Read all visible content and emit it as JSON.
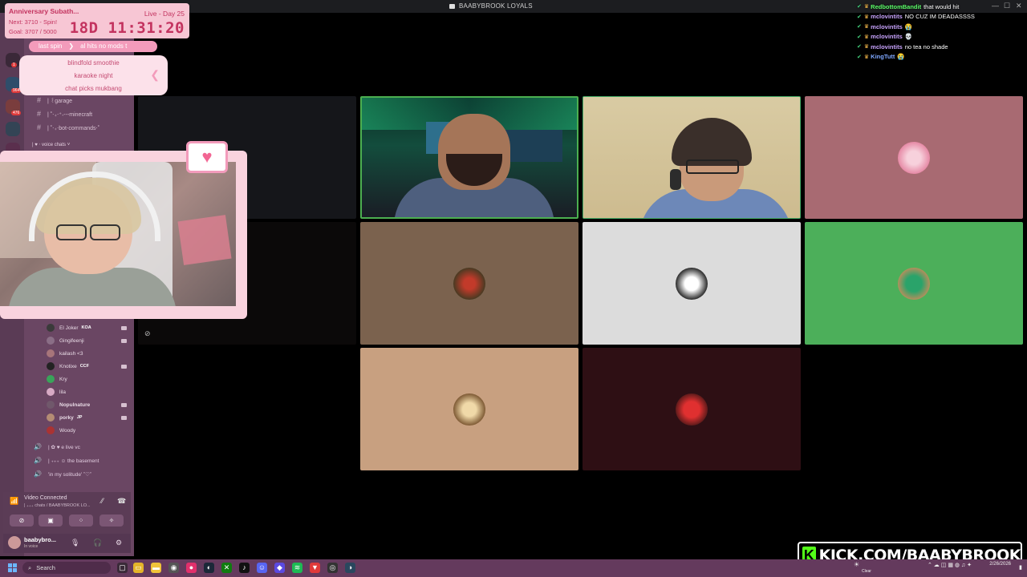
{
  "window": {
    "title": "BAABYBROOK LOYALS"
  },
  "timer": {
    "title": "Anniversary Subath...",
    "next": "Next: 3710 - Spin!",
    "goal": "Goal: 3707 / 5000",
    "live": "Live - Day 25",
    "clock": "18D 11:31:20"
  },
  "spin": {
    "label": "last spin",
    "value": "al hits no mods t"
  },
  "wheel": {
    "options": [
      "blindfold smoothie",
      "karaoke night",
      "chat picks mukbang"
    ]
  },
  "sidebar": {
    "badges": [
      "1",
      "964",
      "476"
    ],
    "channels": [
      {
        "icon": "#",
        "label": "|  ꒰garage"
      },
      {
        "icon": "#",
        "label": "| ˚‧₊‧⁺˖---minecraft"
      },
      {
        "icon": "#",
        "label": "| ˚‧₊‧bot-commands‧˚"
      }
    ],
    "category": "|  ♥  ‧ voice chats  ˅",
    "members": [
      {
        "name": "El Joker",
        "tag": "KOA"
      },
      {
        "name": "Gingifeenji",
        "tag": ""
      },
      {
        "name": "kailash <3",
        "tag": ""
      },
      {
        "name": "Knotixe",
        "tag": "CCF"
      },
      {
        "name": "Kry",
        "tag": ""
      },
      {
        "name": "lila",
        "tag": ""
      },
      {
        "name": "Nopulnature",
        "tag": ""
      },
      {
        "name": "porky",
        "tag": "JP"
      },
      {
        "name": "Woody",
        "tag": ""
      }
    ],
    "voice_channels": [
      "| ✿ ♥ e live vc",
      "| ₊₊₊ ☺ the basement",
      "'in my solitude' ˚♡˚"
    ],
    "video_panel": {
      "title": "Video Connected",
      "subtitle": "| ₊₊₊ chats / BAABYBROOK LO..."
    },
    "user": {
      "name": "baabybro...",
      "status": "In voice"
    }
  },
  "chat": [
    {
      "name": "RedbottomBandit",
      "name_color": "#5dff6a",
      "text": "that would hit"
    },
    {
      "name": "mclovintits",
      "name_color": "#c9a4ff",
      "text": "NO CUZ IM DEADASSSS"
    },
    {
      "name": "mclovintits",
      "name_color": "#c9a4ff",
      "text": "😭"
    },
    {
      "name": "mclovintits",
      "name_color": "#c9a4ff",
      "text": "💀"
    },
    {
      "name": "mclovintits",
      "name_color": "#c9a4ff",
      "text": "no tea no shade"
    },
    {
      "name": "KingTutt",
      "name_color": "#7fa8ff",
      "text": "😭"
    }
  ],
  "kick": {
    "url": "KICK.COM/BAABYBROOK"
  },
  "taskbar": {
    "search_placeholder": "Search",
    "date": "2/26/2026",
    "weather": "Clear"
  },
  "colors": {
    "accent_pink": "#f39bbb",
    "discord_bg": "#6a4663",
    "kick_green": "#53fc18"
  }
}
